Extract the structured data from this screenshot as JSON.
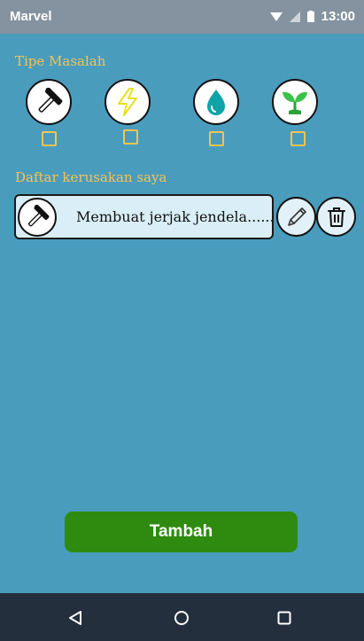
{
  "status_bar": {
    "carrier": "Marvel",
    "time": "13:00"
  },
  "problem_types": {
    "title": "Tipe Masalah",
    "items": [
      {
        "icon": "hammer-icon",
        "checked": false
      },
      {
        "icon": "lightning-icon",
        "checked": false
      },
      {
        "icon": "water-drop-icon",
        "checked": false
      },
      {
        "icon": "plant-sprout-icon",
        "checked": false
      }
    ]
  },
  "damage_list": {
    "title": "Daftar kerusakan saya",
    "items": [
      {
        "icon": "hammer-icon",
        "text": "Membuat jerjak jendela......"
      }
    ]
  },
  "add_button_label": "Tambah",
  "nav": {
    "back": "back-icon",
    "home": "home-icon",
    "recents": "recents-icon"
  },
  "colors": {
    "background": "#4a9cbd",
    "accent": "#f5c350",
    "primary_button": "#2e8b0f"
  }
}
